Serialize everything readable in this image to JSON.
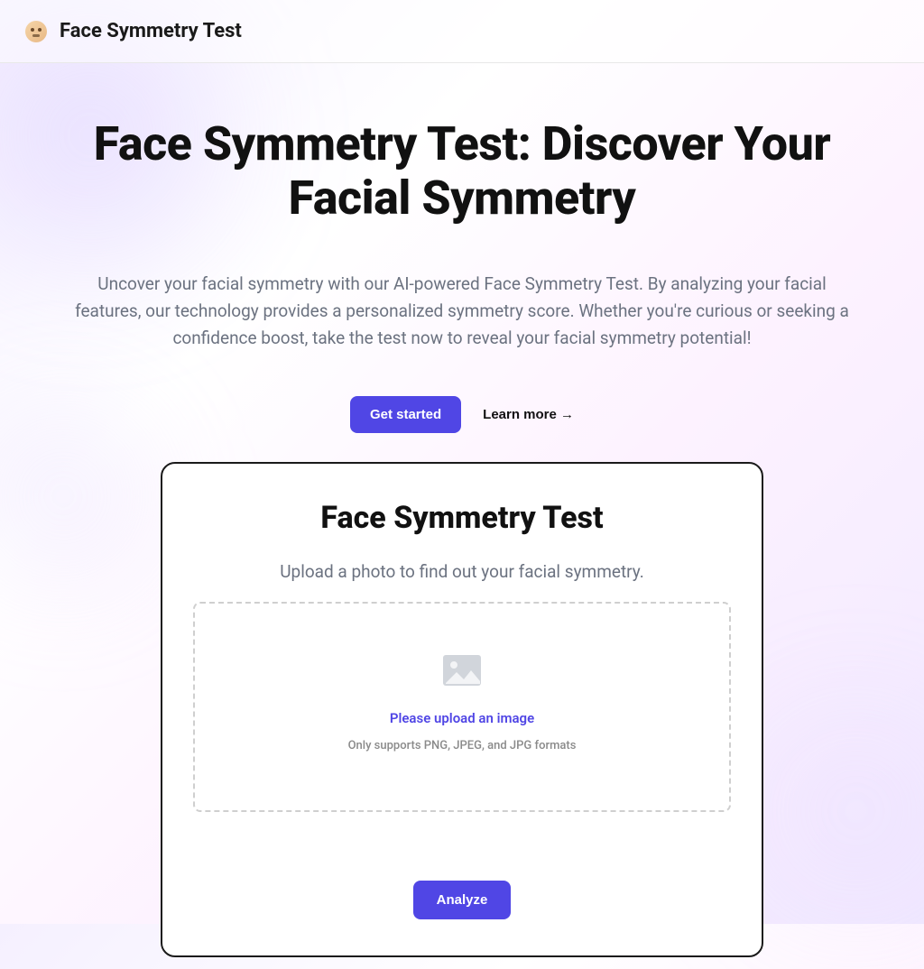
{
  "header": {
    "title": "Face Symmetry Test"
  },
  "hero": {
    "title": "Face Symmetry Test: Discover Your Facial Symmetry",
    "description": "Uncover your facial symmetry with our AI-powered Face Symmetry Test. By analyzing your facial features, our technology provides a personalized symmetry score. Whether you're curious or seeking a confidence boost, take the test now to reveal your facial symmetry potential!",
    "cta_primary": "Get started",
    "cta_secondary": "Learn more →"
  },
  "card": {
    "title": "Face Symmetry Test",
    "subtitle": "Upload a photo to find out your facial symmetry.",
    "dropzone_title": "Please upload an image",
    "dropzone_hint": "Only supports PNG, JPEG, and JPG formats",
    "analyze_button": "Analyze"
  }
}
